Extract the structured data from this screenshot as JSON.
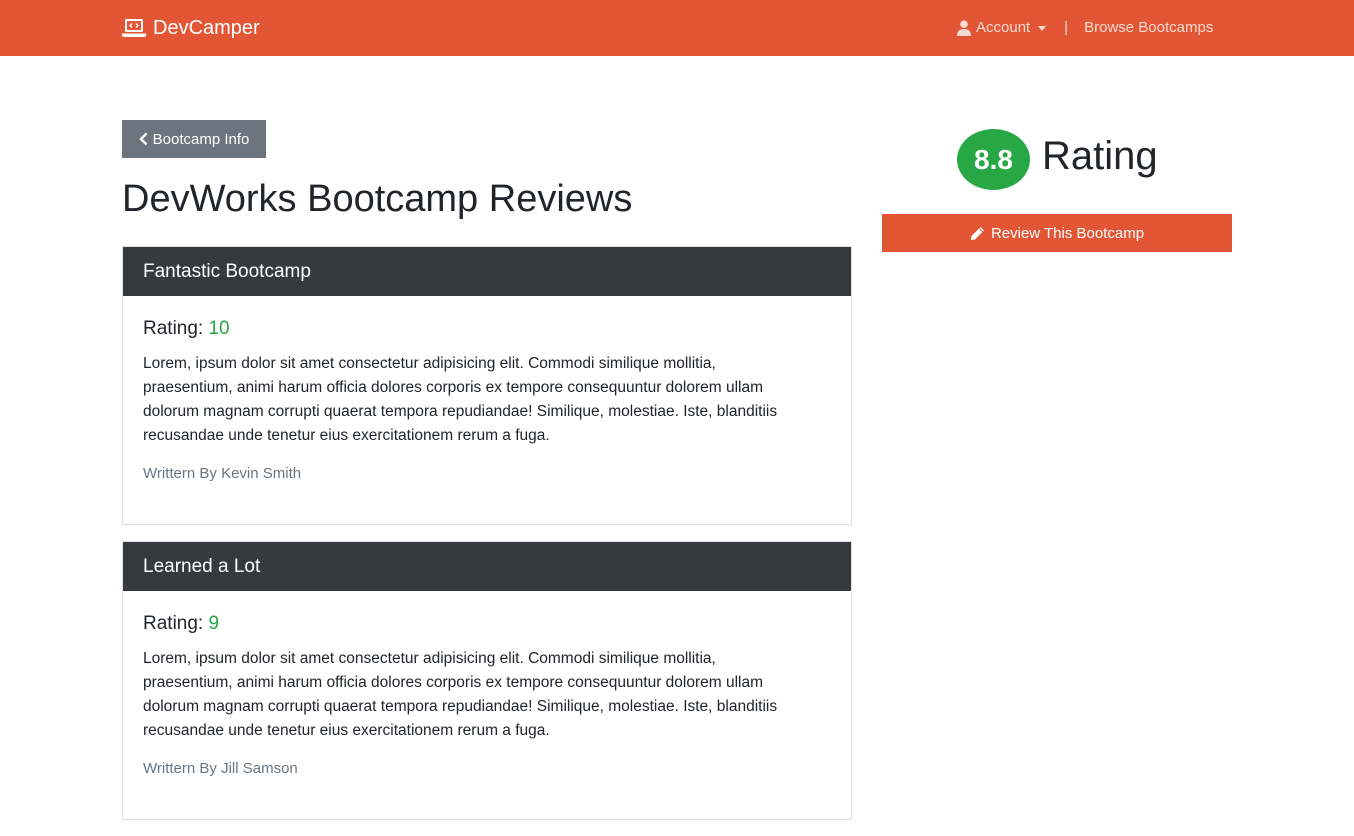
{
  "nav": {
    "brand": "DevCamper",
    "brand_icon": "laptop-code-icon",
    "account_label": "Account",
    "account_icon": "user-icon",
    "separator": "|",
    "browse_label": "Browse Bootcamps"
  },
  "back_button": {
    "label": "Bootcamp Info",
    "icon": "chevron-left-icon"
  },
  "page_title": "DevWorks Bootcamp Reviews",
  "reviews": [
    {
      "title": "Fantastic Bootcamp",
      "rating_label": "Rating:",
      "rating_value": "10",
      "text": "Lorem, ipsum dolor sit amet consectetur adipisicing elit. Commodi similique mollitia, praesentium, animi harum officia dolores corporis ex tempore consequuntur dolorem ullam dolorum magnam corrupti quaerat tempora repudiandae! Similique, molestiae. Iste, blanditiis recusandae unde tenetur eius exercitationem rerum a fuga.",
      "author": "Writtern By Kevin Smith"
    },
    {
      "title": "Learned a Lot",
      "rating_label": "Rating:",
      "rating_value": "9",
      "text": "Lorem, ipsum dolor sit amet consectetur adipisicing elit. Commodi similique mollitia, praesentium, animi harum officia dolores corporis ex tempore consequuntur dolorem ullam dolorum magnam corrupti quaerat tempora repudiandae! Similique, molestiae. Iste, blanditiis recusandae unde tenetur eius exercitationem rerum a fuga.",
      "author": "Writtern By Jill Samson"
    }
  ],
  "sidebar": {
    "average_rating": "8.8",
    "rating_word": "Rating",
    "review_button_label": "Review This Bootcamp",
    "review_button_icon": "pencil-icon"
  },
  "colors": {
    "brand": "#e25635",
    "dark_header": "#343a40",
    "success": "#28a745",
    "secondary": "#6c757d"
  }
}
